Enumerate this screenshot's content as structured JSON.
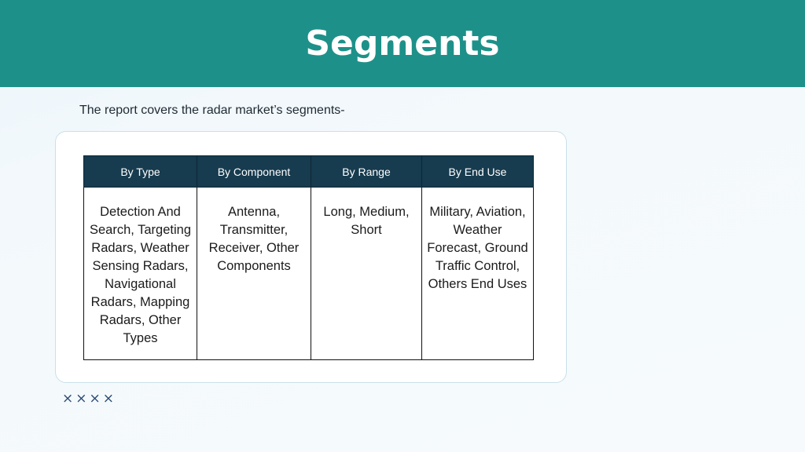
{
  "slide": {
    "title": "Segments",
    "intro": "The report covers the radar market’s segments-",
    "decoration_marks": "××××"
  },
  "table": {
    "headers": [
      "By Type",
      "By Component",
      "By Range",
      "By End Use"
    ],
    "cells": [
      "Detection And Search, Targeting Radars, Weather Sensing Radars, Navigational Radars, Mapping Radars, Other Types",
      "Antenna, Transmitter, Receiver, Other Components",
      "Long, Medium, Short",
      "Military, Aviation, Weather Forecast, Ground Traffic Control, Others End Uses"
    ]
  },
  "colors": {
    "header_band": "#1d9189",
    "table_header": "#173b4f",
    "marks": "#2b4a73"
  }
}
